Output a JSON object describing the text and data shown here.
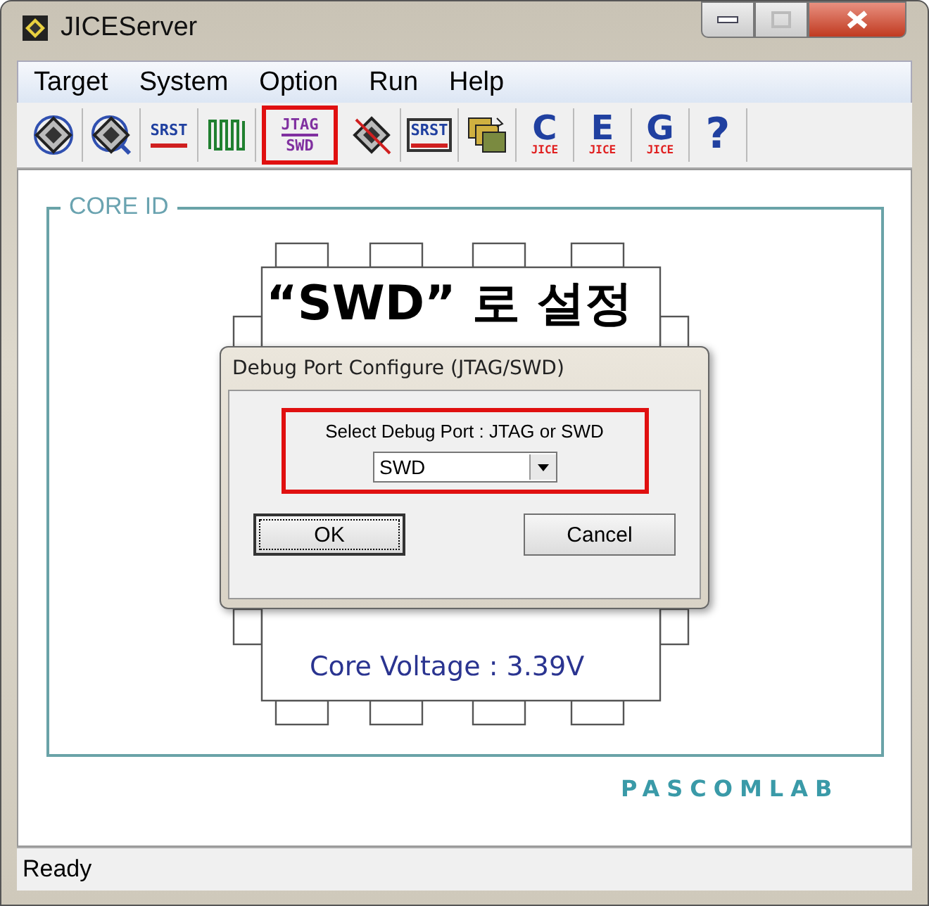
{
  "window": {
    "title": "JICEServer"
  },
  "menu": [
    {
      "label": "Target"
    },
    {
      "label": "System"
    },
    {
      "label": "Option"
    },
    {
      "label": "Run"
    },
    {
      "label": "Help"
    }
  ],
  "toolbar": [
    {
      "kind": "chip",
      "highlighted": false
    },
    {
      "kind": "chip-search",
      "highlighted": false
    },
    {
      "kind": "srst",
      "lines": [
        "SRST"
      ],
      "highlighted": false
    },
    {
      "kind": "wave",
      "highlighted": false
    },
    {
      "kind": "text",
      "lines": [
        "JTAG",
        "SWD"
      ],
      "highlighted": true
    },
    {
      "kind": "chip-cross",
      "highlighted": false
    },
    {
      "kind": "srst-box",
      "lines": [
        "SRST"
      ],
      "highlighted": false
    },
    {
      "kind": "stack",
      "highlighted": false
    },
    {
      "kind": "jice",
      "lines": [
        "C",
        "JICE"
      ],
      "highlighted": false
    },
    {
      "kind": "jice",
      "lines": [
        "E",
        "JICE"
      ],
      "highlighted": false
    },
    {
      "kind": "jice",
      "lines": [
        "G",
        "JICE"
      ],
      "highlighted": false
    },
    {
      "kind": "help",
      "lines": [
        "?"
      ],
      "highlighted": false
    }
  ],
  "core_group": {
    "legend": "CORE ID",
    "core_voltage": "Core Voltage : 3.39V",
    "brand": "PASCOMLAB"
  },
  "annotation": "“SWD” 로 설정",
  "dialog": {
    "title": "Debug Port Configure (JTAG/SWD)",
    "prompt": "Select Debug Port : JTAG or SWD",
    "prompt_highlighted": true,
    "port": {
      "value": "SWD"
    },
    "buttons": [
      {
        "label": "OK",
        "default": true
      },
      {
        "label": "Cancel",
        "default": false
      }
    ]
  },
  "status_bar": "Ready"
}
